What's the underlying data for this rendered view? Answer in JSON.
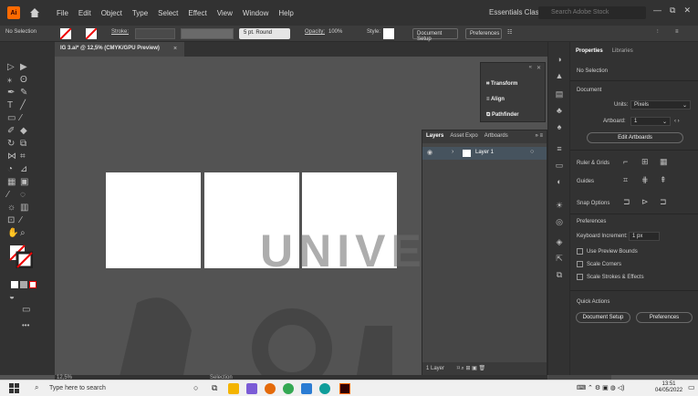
{
  "menubar": {
    "app_logo": "Ai",
    "menus": [
      "File",
      "Edit",
      "Object",
      "Type",
      "Select",
      "Effect",
      "View",
      "Window",
      "Help"
    ],
    "workspace": "Essentials Classic",
    "search_placeholder": "Search Adobe Stock",
    "win_controls": [
      "—",
      "⧉",
      "✕"
    ]
  },
  "controlbar": {
    "selection_label": "No Selection",
    "stroke_label": "Stroke:",
    "brush": "5 pt. Round",
    "opacity_label": "Opacity:",
    "opacity_value": "100%",
    "style_label": "Style:",
    "document_setup": "Document Setup",
    "preferences": "Preferences"
  },
  "document": {
    "tab_title": "IG 3.ai* @ 12,5% (CMYK/GPU Preview)",
    "close_glyph": "×"
  },
  "float_panel": {
    "items": [
      "Transform",
      "Align",
      "Pathfinder"
    ]
  },
  "layers_panel": {
    "tabs": [
      "Layers",
      "Asset Expo",
      "Artboards"
    ],
    "layer_name": "Layer 1",
    "layer_count": "1 Layer"
  },
  "properties": {
    "tabs": [
      "Properties",
      "Libraries"
    ],
    "selection": "No Selection",
    "document_heading": "Document",
    "units_label": "Units:",
    "units_value": "Pixels",
    "artboard_label": "Artboard:",
    "artboard_value": "1",
    "edit_artboards": "Edit Artboards",
    "rulers_grids": "Ruler & Grids",
    "guides": "Guides",
    "snap_options": "Snap Options",
    "preferences_heading": "Preferences",
    "keyboard_increment_label": "Keyboard Increment:",
    "keyboard_increment_value": "1 px",
    "checks": [
      "Use Preview Bounds",
      "Scale Corners",
      "Scale Strokes & Effects"
    ],
    "quick_actions": "Quick Actions",
    "document_setup_btn": "Document Setup",
    "preferences_btn": "Preferences"
  },
  "statusbar": {
    "zoom": "12,5%",
    "tool": "Selection"
  },
  "taskbar": {
    "search_placeholder": "Type here to search",
    "time": "13:51",
    "date": "04/05/2022"
  },
  "watermark": {
    "text": "UNIVERSITAS"
  },
  "colors": {
    "app_dark": "#323232",
    "canvas": "#535353",
    "illustrator_orange": "#ff6a00",
    "layer_blue": "#46535e"
  }
}
